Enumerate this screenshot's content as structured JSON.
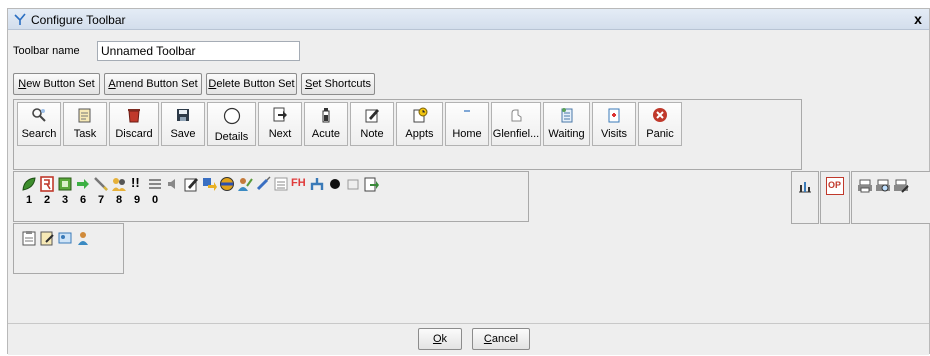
{
  "window": {
    "title": "Configure Toolbar",
    "close_label": "x"
  },
  "toolbar_name": {
    "label": "Toolbar name",
    "value": "Unnamed Toolbar"
  },
  "actions": [
    {
      "accel": "N",
      "rest": "ew Button Set"
    },
    {
      "accel": "A",
      "rest": "mend Button Set"
    },
    {
      "accel": "D",
      "rest": "elete Button Set"
    },
    {
      "accel": "S",
      "rest": "et Shortcuts"
    }
  ],
  "main_buttons": [
    {
      "label": "Search",
      "icon": "search-icon"
    },
    {
      "label": "Task",
      "icon": "task-icon"
    },
    {
      "label": "Discard",
      "icon": "discard-icon"
    },
    {
      "label": "Save",
      "icon": "save-icon"
    },
    {
      "label": "Details",
      "icon": "circle-icon"
    },
    {
      "label": "Next",
      "icon": "next-icon"
    },
    {
      "label": "Acute",
      "icon": "acute-icon"
    },
    {
      "label": "Note",
      "icon": "note-icon"
    },
    {
      "label": "Appts",
      "icon": "appointments-icon"
    },
    {
      "label": "Home",
      "icon": "home-icon"
    },
    {
      "label": "Glenfiel...",
      "icon": "glenfield-icon"
    },
    {
      "label": "Waiting",
      "icon": "waiting-icon"
    },
    {
      "label": "Visits",
      "icon": "visits-icon"
    },
    {
      "label": "Panic",
      "icon": "panic-icon"
    }
  ],
  "shortcut_numbers": [
    "1",
    "2",
    "3",
    "6",
    "7",
    "8",
    "9",
    "0"
  ],
  "icon_text": {
    "fh": "FH",
    "exclaim": "!!",
    "op": "OP"
  },
  "footer": {
    "ok_accel": "O",
    "ok_rest": "k",
    "cancel_accel": "C",
    "cancel_rest": "ancel"
  }
}
